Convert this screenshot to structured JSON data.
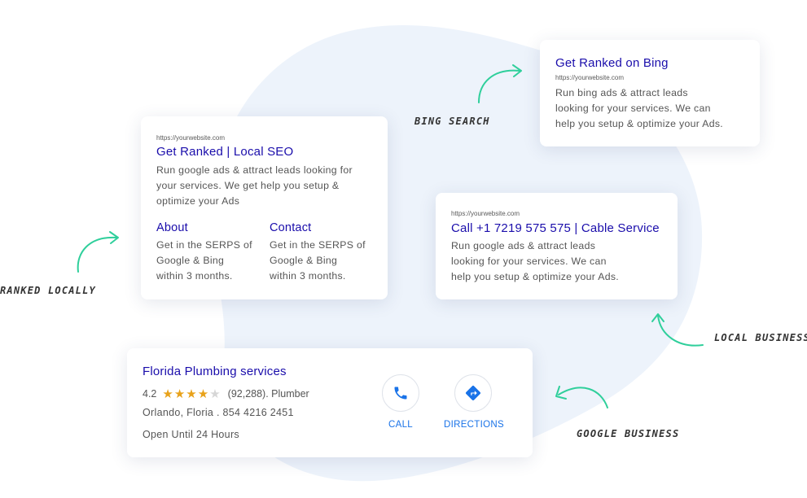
{
  "colors": {
    "accent": "#2fcf9b",
    "link": "#1a0dab",
    "star": "#e8a21a",
    "blob": "#edf3fb"
  },
  "bing_card": {
    "title": "Get Ranked on Bing",
    "url": "https://yourwebsite.com",
    "description": [
      "Run bing ads & attract leads",
      "looking for your services. We can",
      "help you setup & optimize your Ads."
    ]
  },
  "seo_card": {
    "url": "https://yourwebsite.com",
    "title": "Get Ranked | Local SEO",
    "description": [
      "Run google ads & attract leads looking for",
      "your services. We get help you setup &",
      "optimize your Ads"
    ],
    "sitelinks": [
      {
        "title": "About",
        "lines": [
          "Get in the SERPS of",
          "Google & Bing",
          "within 3 months."
        ]
      },
      {
        "title": "Contact",
        "lines": [
          "Get in the SERPS of",
          "Google & Bing",
          "within 3 months."
        ]
      }
    ]
  },
  "call_card": {
    "url": "https://yourwebsite.com",
    "title": "Call +1 7219 575 575 | Cable Service",
    "description": [
      "Run google ads & attract leads",
      "looking for your services. We can",
      "help you setup & optimize your Ads."
    ]
  },
  "business_card": {
    "name": "Florida Plumbing services",
    "rating": "4.2",
    "stars_filled": 4,
    "stars_total": 5,
    "reviews": "(92,288). Plumber",
    "address": "Orlando, Floria . 854 4216 2451",
    "hours": "Open Until 24 Hours",
    "call_label": "CALL",
    "directions_label": "DIRECTIONS"
  },
  "annotations": {
    "bing_search": "BING SEARCH",
    "ranked_locally": "RANKED LOCALLY",
    "local_business": "LOCAL BUSINESS",
    "google_business": "GOOGLE BUSINESS"
  },
  "icons": {
    "call": "phone-icon",
    "directions": "directions-icon",
    "star": "star-icon",
    "arrow": "curved-arrow-icon"
  }
}
